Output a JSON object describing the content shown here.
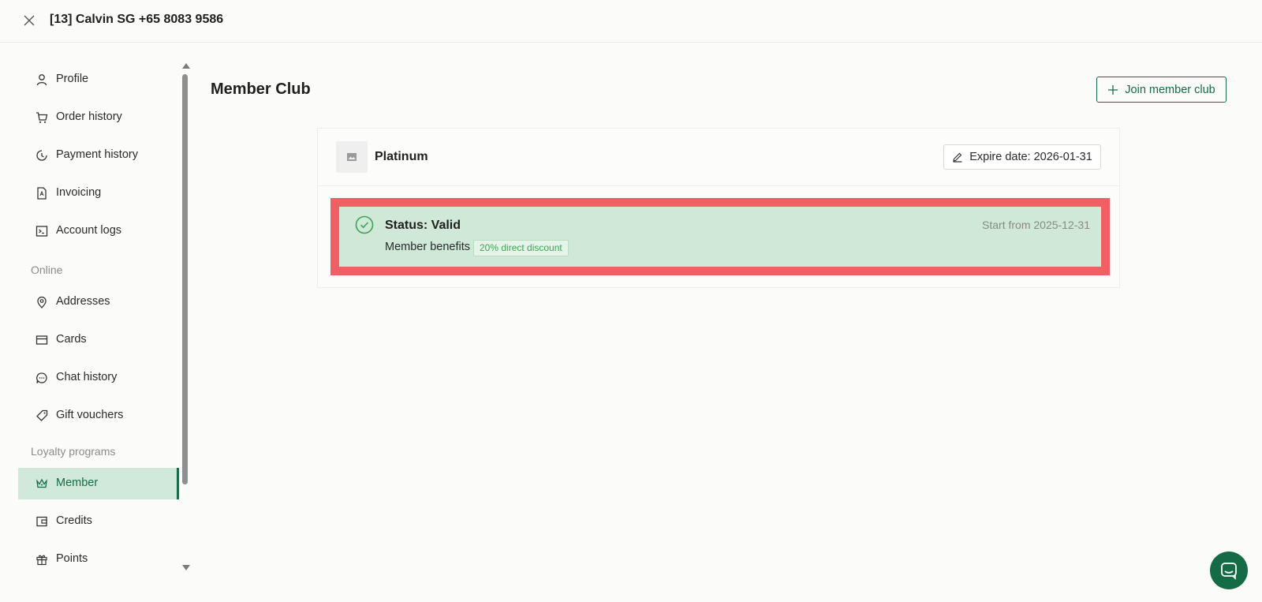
{
  "header": {
    "title": "[13] Calvin SG +65 8083 9586",
    "close_icon": "close-icon"
  },
  "sidebar": {
    "items": [
      {
        "label": "Profile",
        "icon": "user-icon"
      },
      {
        "label": "Order history",
        "icon": "cart-icon"
      },
      {
        "label": "Payment history",
        "icon": "history-icon"
      },
      {
        "label": "Invoicing",
        "icon": "pdf-file-icon"
      },
      {
        "label": "Account logs",
        "icon": "terminal-icon"
      },
      {
        "label": "Addresses",
        "icon": "location-pin-icon"
      },
      {
        "label": "Cards",
        "icon": "credit-card-icon"
      },
      {
        "label": "Chat history",
        "icon": "chat-bubble-icon"
      },
      {
        "label": "Gift vouchers",
        "icon": "tag-icon"
      },
      {
        "label": "Member",
        "icon": "crown-icon",
        "active": true
      },
      {
        "label": "Credits",
        "icon": "wallet-icon"
      },
      {
        "label": "Points",
        "icon": "gift-icon"
      }
    ],
    "sections": {
      "online": "Online",
      "loyalty": "Loyalty programs"
    }
  },
  "main": {
    "title": "Member Club",
    "join_button_label": "Join member club",
    "card": {
      "tier_name": "Platinum",
      "expire_label": "Expire date: 2026-01-31",
      "status_label": "Status: Valid",
      "start_label": "Start from 2025-12-31",
      "benefits_label": "Member benefits",
      "benefit_tag": "20% direct discount"
    }
  },
  "colors": {
    "brand_green": "#146b45",
    "active_bg": "#d1e9da",
    "highlight_border": "#ef5f63",
    "highlight_bg": "#cfe8d8",
    "success_green": "#3ea255"
  }
}
